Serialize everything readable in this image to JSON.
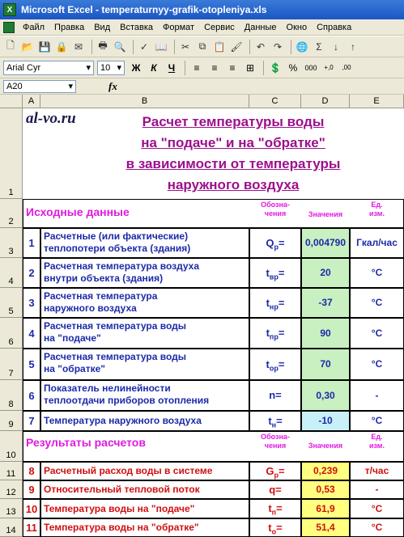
{
  "window": {
    "title": "Microsoft Excel - temperaturnyy-grafik-otopleniya.xls",
    "logo": "X"
  },
  "menu": [
    "Файл",
    "Правка",
    "Вид",
    "Вставка",
    "Формат",
    "Сервис",
    "Данные",
    "Окно",
    "Справка"
  ],
  "toolbar_format": {
    "font": "Arial Cyr",
    "size": "10",
    "bold": "Ж",
    "italic": "К",
    "underline": "Ч"
  },
  "formula_bar": {
    "namebox": "A20",
    "fx": "fx"
  },
  "columns": [
    "A",
    "B",
    "C",
    "D",
    "E"
  ],
  "rows": [
    "1",
    "2",
    "3",
    "4",
    "5",
    "6",
    "7",
    "8",
    "9",
    "10",
    "11",
    "12",
    "13",
    "14"
  ],
  "sheet": {
    "watermark": "al-vo.ru",
    "title": [
      "Расчет температуры воды",
      "на \"подаче\" и на \"обратке\"",
      "в зависимости от температуры",
      "наружного воздуха"
    ],
    "input_section": "Исходные данные",
    "result_section": "Результаты расчетов",
    "headers": {
      "symbol": [
        "Обозна-",
        "чения"
      ],
      "value": "Значения",
      "unit": [
        "Ед.",
        "изм."
      ]
    },
    "inputs": [
      {
        "n": "1",
        "desc": [
          "Расчетные (или фактические)",
          "теплопотери объекта (здания)"
        ],
        "sym": "Q",
        "sub": "р",
        "eq": "=",
        "val": "0,004790",
        "unit": "Гкал/час"
      },
      {
        "n": "2",
        "desc": [
          "Расчетная температура воздуха",
          "внутри объекта (здания)"
        ],
        "sym": "t",
        "sub": "вр",
        "eq": "=",
        "val": "20",
        "unit": "°C"
      },
      {
        "n": "3",
        "desc": [
          "Расчетная температура",
          "наружного воздуха"
        ],
        "sym": "t",
        "sub": "нр",
        "eq": "=",
        "val": "-37",
        "unit": "°C"
      },
      {
        "n": "4",
        "desc": [
          "Расчетная температура воды",
          "на \"подаче\""
        ],
        "sym": "t",
        "sub": "пр",
        "eq": "=",
        "val": "90",
        "unit": "°C"
      },
      {
        "n": "5",
        "desc": [
          "Расчетная температура воды",
          "на \"обратке\""
        ],
        "sym": "t",
        "sub": "ор",
        "eq": "=",
        "val": "70",
        "unit": "°C"
      },
      {
        "n": "6",
        "desc": [
          "Показатель нелинейности",
          "теплоотдачи приборов отопления"
        ],
        "sym": "n",
        "sub": "",
        "eq": "=",
        "val": "0,30",
        "unit": "-"
      },
      {
        "n": "7",
        "desc": [
          "Температура наружного воздуха"
        ],
        "sym": "t",
        "sub": "н",
        "eq": "=",
        "val": "-10",
        "unit": "°C"
      }
    ],
    "results": [
      {
        "n": "8",
        "desc": "Расчетный расход воды в системе",
        "sym": "G",
        "sub": "р",
        "eq": "=",
        "val": "0,239",
        "unit": "т/час"
      },
      {
        "n": "9",
        "desc": "Относительный тепловой поток",
        "sym": "q",
        "sub": "",
        "eq": "=",
        "val": "0,53",
        "unit": "-"
      },
      {
        "n": "10",
        "desc": "Температура воды на \"подаче\"",
        "sym": "t",
        "sub": "п",
        "eq": "=",
        "val": "61,9",
        "unit": "°C"
      },
      {
        "n": "11",
        "desc": "Температура воды на \"обратке\"",
        "sym": "t",
        "sub": "о",
        "eq": "=",
        "val": "51,4",
        "unit": "°C"
      }
    ]
  },
  "colors": {
    "title": "#9c108c",
    "section": "#e01ae0",
    "blue_text": "#1c2aa8",
    "red_text": "#d01010",
    "input_fill": "#c8f0c0",
    "result_fill": "#ffff80",
    "ext_fill": "#c8f0f8"
  }
}
